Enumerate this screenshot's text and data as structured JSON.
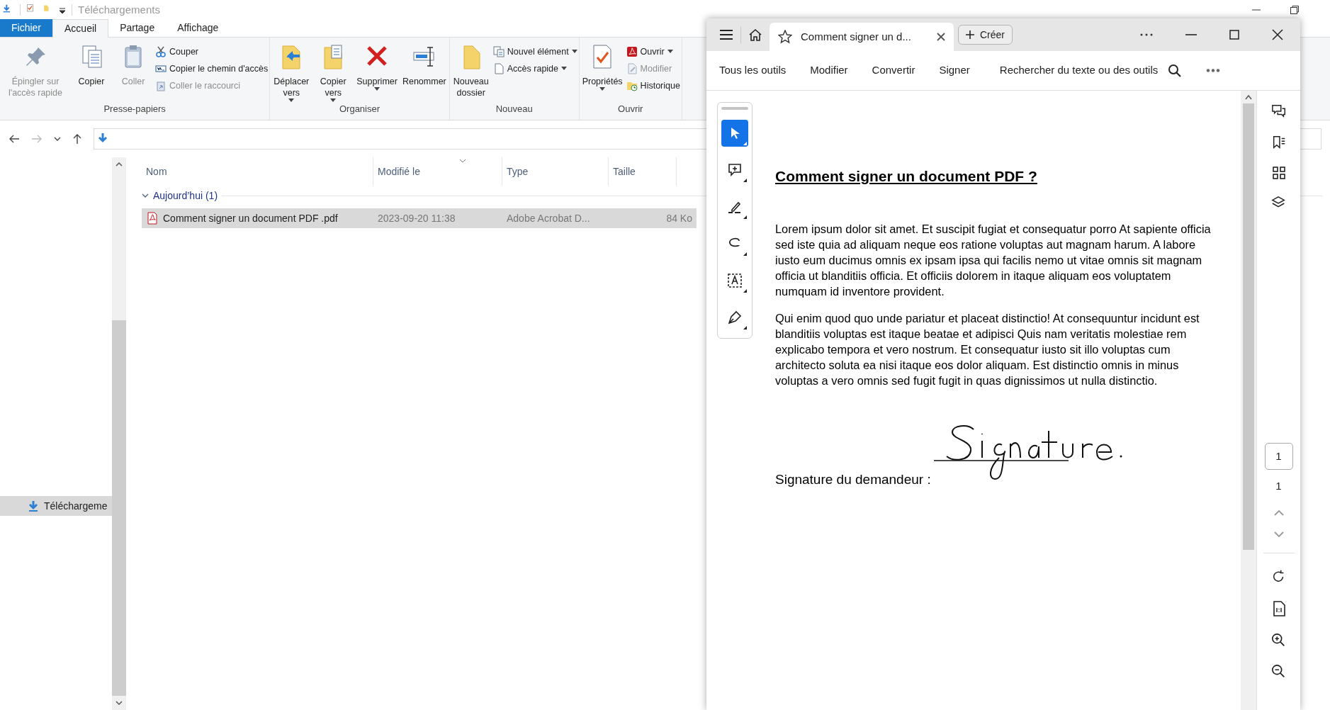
{
  "explorer": {
    "title": "Téléchargements",
    "ribbon_tabs": [
      {
        "label": "Fichier",
        "kind": "file",
        "selected": false
      },
      {
        "label": "Accueil",
        "kind": "tab",
        "selected": true
      },
      {
        "label": "Partage",
        "kind": "tab",
        "selected": false
      },
      {
        "label": "Affichage",
        "kind": "tab",
        "selected": false
      }
    ],
    "ribbon_groups": [
      {
        "label": "Presse-papiers",
        "big": [
          {
            "label": "Épingler sur l'accès rapide",
            "kind": "pin",
            "disabled": true,
            "dropdown": false
          },
          {
            "label": "Copier",
            "kind": "copy",
            "disabled": false,
            "dropdown": false
          },
          {
            "label": "Coller",
            "kind": "paste",
            "disabled": true,
            "dropdown": false
          }
        ],
        "small": [
          {
            "label": "Couper",
            "kind": "cut",
            "disabled": false,
            "dropdown": false
          },
          {
            "label": "Copier le chemin d'accès",
            "kind": "path",
            "disabled": false,
            "dropdown": false
          },
          {
            "label": "Coller le raccourci",
            "kind": "shortcut",
            "disabled": true,
            "dropdown": false
          }
        ]
      },
      {
        "label": "Organiser",
        "big": [
          {
            "label": "Déplacer vers",
            "kind": "move",
            "disabled": false,
            "dropdown": true
          },
          {
            "label": "Copier vers",
            "kind": "copyto",
            "disabled": false,
            "dropdown": true
          },
          {
            "label": "Supprimer",
            "kind": "delete",
            "disabled": false,
            "dropdown": true
          },
          {
            "label": "Renommer",
            "kind": "rename",
            "disabled": false,
            "dropdown": false
          }
        ]
      },
      {
        "label": "Nouveau",
        "big": [
          {
            "label": "Nouveau dossier",
            "kind": "folder",
            "disabled": false,
            "dropdown": false
          }
        ],
        "small": [
          {
            "label": "Nouvel élément",
            "kind": "newitem",
            "disabled": false,
            "dropdown": true
          },
          {
            "label": "Accès rapide",
            "kind": "quick",
            "disabled": false,
            "dropdown": true
          }
        ]
      },
      {
        "label": "Ouvrir",
        "big": [
          {
            "label": "Propriétés",
            "kind": "props",
            "disabled": false,
            "dropdown": true
          }
        ],
        "small": [
          {
            "label": "Ouvrir",
            "kind": "pdf",
            "disabled": false,
            "dropdown": true
          },
          {
            "label": "Modifier",
            "kind": "edit",
            "disabled": true,
            "dropdown": false
          },
          {
            "label": "Historique",
            "kind": "history",
            "disabled": false,
            "dropdown": false
          }
        ]
      }
    ],
    "columns": [
      "Nom",
      "Modifié le",
      "Type",
      "Taille"
    ],
    "group": {
      "label": "Aujourd’hui (1)",
      "expanded": true
    },
    "files": [
      {
        "name": "Comment signer un document PDF .pdf",
        "modified": "2023-09-20 11:38",
        "type": "Adobe Acrobat D...",
        "size": "84 Ko",
        "selected": true
      }
    ],
    "nav_items": [
      {
        "label": "Téléchargeme",
        "selected": true
      }
    ]
  },
  "acrobat": {
    "tab_title": "Comment signer un d...",
    "create": "Créer",
    "menu": [
      "Tous les outils",
      "Modifier",
      "Convertir",
      "Signer"
    ],
    "search": "Rechercher du texte ou des outils",
    "tools": [
      {
        "kind": "select",
        "selected": true
      },
      {
        "kind": "comment",
        "selected": false
      },
      {
        "kind": "highlight",
        "selected": false
      },
      {
        "kind": "draw",
        "selected": false
      },
      {
        "kind": "textbox",
        "selected": false
      },
      {
        "kind": "sign",
        "selected": false
      }
    ],
    "document": {
      "title": "Comment signer un document PDF ?",
      "paragraphs": [
        "Lorem ipsum dolor sit amet. Et suscipit fugiat et consequatur porro At sapiente officia sed iste quia ad aliquam neque eos ratione voluptas aut magnam harum. A labore iusto eum ducimus omnis ex ipsam ipsa qui facilis nemo ut vitae omnis sit magnam officia ut blanditiis officia. Et officiis dolorem in itaque aliquam eos voluptatem numquam id inventore provident.",
        "Qui enim quod quo unde pariatur et placeat distinctio! At consequuntur incidunt est blanditiis voluptas est itaque beatae et adipisci Quis nam veritatis molestiae rem explicabo tempora et vero nostrum. Et consequatur iusto sit illo voluptas cum architecto soluta ea nisi itaque eos dolor aliquam. Est distinctio omnis in minus voluptas a vero omnis sed fugit fugit in quas dignissimos ut nulla distinctio."
      ],
      "signature_label": "Signature du demandeur :"
    },
    "page": {
      "current": "1",
      "total": "1"
    }
  }
}
